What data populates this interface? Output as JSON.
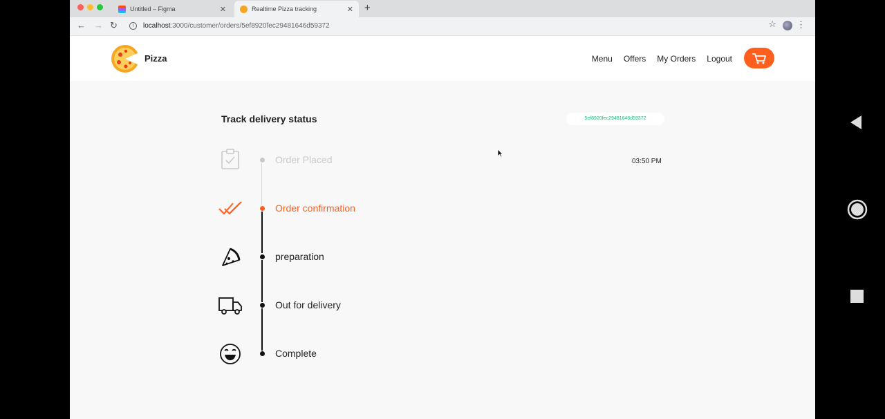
{
  "browser": {
    "tabs": [
      {
        "label": "Untitled – Figma",
        "close": "✕"
      },
      {
        "label": "Realtime Pizza tracking",
        "close": "✕"
      }
    ],
    "new_tab": "+",
    "url_host": "localhost",
    "url_rest": ":3000/customer/orders/5ef8920fec29481646d59372"
  },
  "site": {
    "brand": "Pizza",
    "nav": [
      "Menu",
      "Offers",
      "My Orders",
      "Logout"
    ]
  },
  "tracking": {
    "title": "Track delivery status",
    "order_id": "5ef8920fec29481646d59372",
    "steps": [
      {
        "label": "Order Placed",
        "icon": "clipboard-check-icon",
        "state": "done",
        "time": "03:50 PM"
      },
      {
        "label": "Order confirmation",
        "icon": "double-check-icon",
        "state": "current"
      },
      {
        "label": "preparation",
        "icon": "pizza-slice-icon",
        "state": "pending"
      },
      {
        "label": "Out for delivery",
        "icon": "delivery-truck-icon",
        "state": "pending"
      },
      {
        "label": "Complete",
        "icon": "smile-icon",
        "state": "pending"
      }
    ]
  },
  "colors": {
    "accent": "#fe5f1e",
    "done": "#c9c9c9",
    "pending": "#111111",
    "order_id": "#2ab97a"
  }
}
